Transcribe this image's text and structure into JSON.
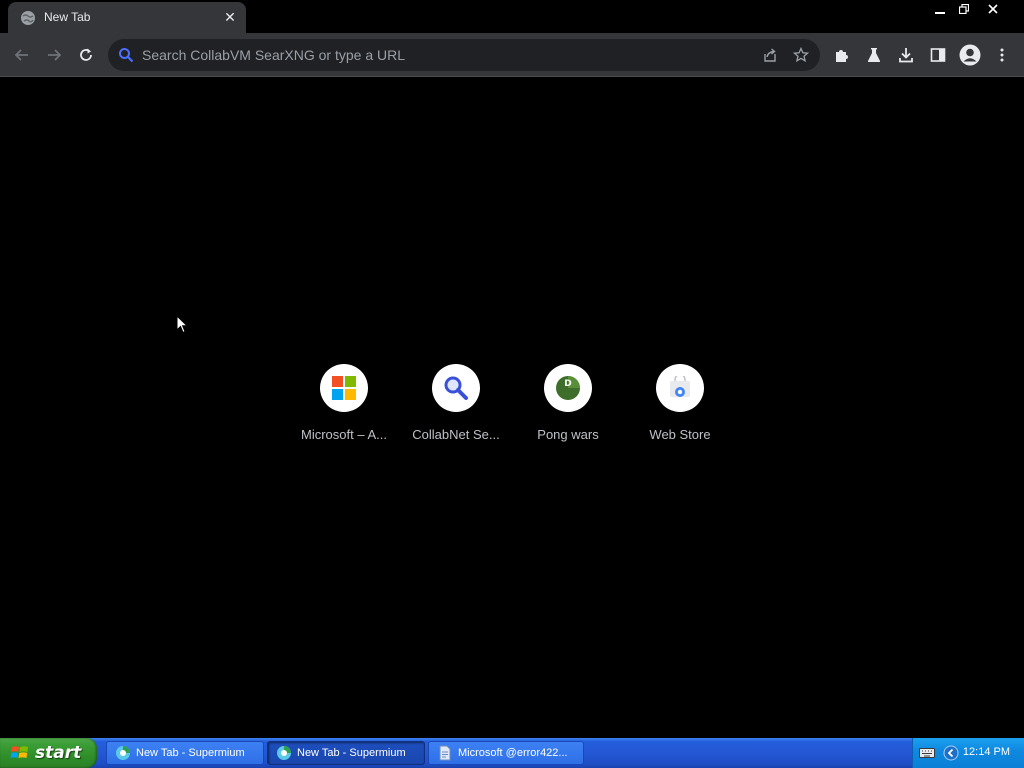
{
  "browser": {
    "tab": {
      "title": "New Tab",
      "close_glyph": "✕"
    },
    "omnibox": {
      "placeholder": "Search CollabVM SearXNG or type a URL",
      "value": ""
    }
  },
  "ntp": {
    "shortcuts": [
      {
        "label": "Microsoft – A...",
        "icon": "microsoft-logo-icon"
      },
      {
        "label": "CollabNet Se...",
        "icon": "magnifier-icon"
      },
      {
        "label": "Pong wars",
        "icon": "pong-wars-icon"
      },
      {
        "label": "Web Store",
        "icon": "web-store-icon"
      }
    ]
  },
  "taskbar": {
    "start_label": "start",
    "tasks": [
      {
        "label": "New Tab - Supermium",
        "state": "inactive"
      },
      {
        "label": "New Tab - Supermium",
        "state": "active"
      },
      {
        "label": "Microsoft @error422...",
        "state": "inactive"
      }
    ],
    "clock": "12:14 PM"
  },
  "colors": {
    "toolbar": "#35363a",
    "omnibox": "#202124",
    "ntp_background": "#000000",
    "taskbar_blue": "#245edb",
    "start_green": "#3c9e37"
  }
}
